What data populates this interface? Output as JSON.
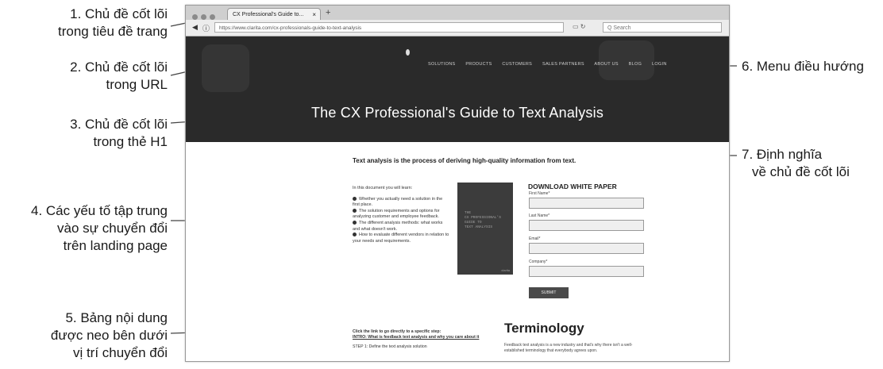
{
  "annotations": {
    "a1": {
      "line1": "1. Chủ đề cốt lõi",
      "line2": "trong tiêu đề trang"
    },
    "a2": {
      "line1": "2. Chủ đề cốt lõi",
      "line2": "trong URL"
    },
    "a3": {
      "line1": "3. Chủ đề cốt lõi",
      "line2": "trong thẻ H1"
    },
    "a4": {
      "line1": "4. Các yếu tố tập trung",
      "line2": "vào sự chuyển đổi",
      "line3": "trên landing page"
    },
    "a5": {
      "line1": "5. Bảng nội dung",
      "line2": "được neo bên dưới",
      "line3": "vị trí chuyển đổi"
    },
    "a6": {
      "line1": "6. Menu điều hướng"
    },
    "a7": {
      "line1": "7. Định nghĩa",
      "line2": "về chủ đề cốt lõi"
    }
  },
  "browser": {
    "tab_title": "CX Professional's Guide to...",
    "tab_close": "×",
    "new_tab": "+",
    "url": "https://www.clarita.com/cx-professionals-guide-to-text-analysis",
    "search_placeholder": "Q Search"
  },
  "page": {
    "menu_items": [
      "SOLUTIONS",
      "PRODUCTS",
      "CUSTOMERS",
      "SALES PARTNERS",
      "ABOUT US",
      "BLOG",
      "LOGIN"
    ],
    "h1": "The CX Professional's Guide to Text Analysis",
    "definition": "Text analysis is the process of deriving high-quality information from text.",
    "learn_intro": "In this document you will learn:",
    "learn_items": [
      "Whether you actually need a solution in the first place.",
      "The solution requirements and options for analyzing customer and employee feedback.",
      "The different analysis methods: what works and what doesn't work.",
      "How to evaluate different vendors in relation to your needs and requirements."
    ],
    "cover_text": [
      "THE",
      "CX PROFESSIONAL'S",
      "GUIDE TO",
      "TEXT ANALYSIS"
    ],
    "cover_logo": "clarita",
    "download_title": "DOWNLOAD WHITE PAPER",
    "fields": [
      "First Name*",
      "Last Name*",
      "Email*",
      "Company*"
    ],
    "submit_label": "SUBMIT",
    "toc_intro": "Click the link to go directly to a specific step:",
    "toc_link": "INTRO: What is feedback text analysis and why you care about it",
    "toc_step": "STEP 1: Define the text analysis solution",
    "term_title": "Terminology",
    "term_text": "Feedback text analysis is a new industry and that's why there isn't a well-established terminology that everybody agrees upon."
  }
}
